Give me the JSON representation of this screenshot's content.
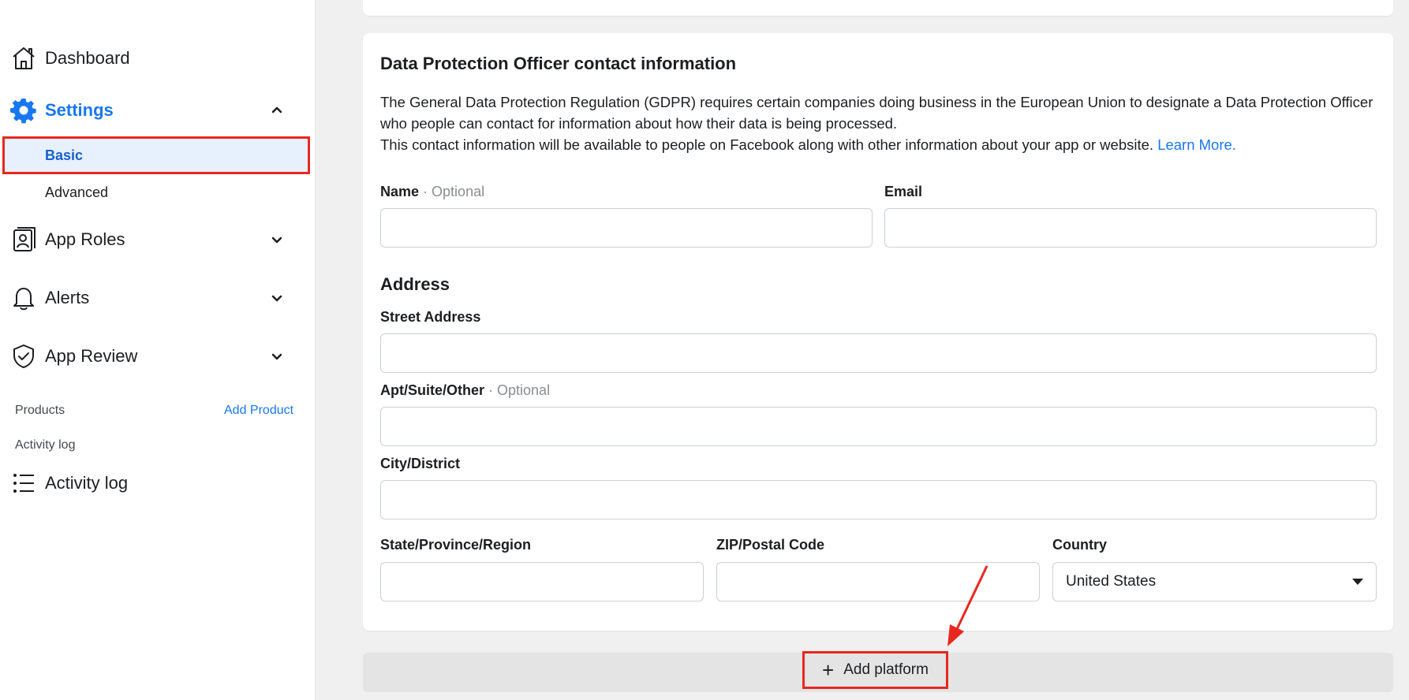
{
  "sidebar": {
    "items": [
      {
        "label": "Dashboard",
        "icon": "home-icon"
      },
      {
        "label": "Settings",
        "icon": "gear-icon"
      },
      {
        "label": "App Roles",
        "icon": "id-badge-icon"
      },
      {
        "label": "Alerts",
        "icon": "bell-icon"
      },
      {
        "label": "App Review",
        "icon": "shield-check-icon"
      }
    ],
    "settings_sub": [
      {
        "label": "Basic"
      },
      {
        "label": "Advanced"
      }
    ],
    "products_label": "Products",
    "add_product_label": "Add Product",
    "activity_section_label": "Activity log",
    "activity_item_label": "Activity log",
    "accent_color": "#1877f2"
  },
  "dpo": {
    "title": "Data Protection Officer contact information",
    "desc_line1": "The General Data Protection Regulation (GDPR) requires certain companies doing business in the European Union to designate a Data Protection Officer who people can contact for information about how their data is being processed.",
    "desc_line2": "This contact information will be available to people on Facebook along with other information about your app or website.",
    "learn_more": "Learn More.",
    "name_label": "Name",
    "optional_text": "· Optional",
    "email_label": "Email",
    "name_value": "",
    "email_value": ""
  },
  "address": {
    "title": "Address",
    "street_label": "Street Address",
    "apt_label": "Apt/Suite/Other",
    "city_label": "City/District",
    "state_label": "State/Province/Region",
    "zip_label": "ZIP/Postal Code",
    "country_label": "Country",
    "country_value": "United States",
    "street_value": "",
    "apt_value": "",
    "city_value": "",
    "state_value": "",
    "zip_value": ""
  },
  "add_platform": {
    "label": "Add platform",
    "icon": "plus-icon"
  },
  "annotation": {
    "highlight_color": "#e8281f"
  }
}
